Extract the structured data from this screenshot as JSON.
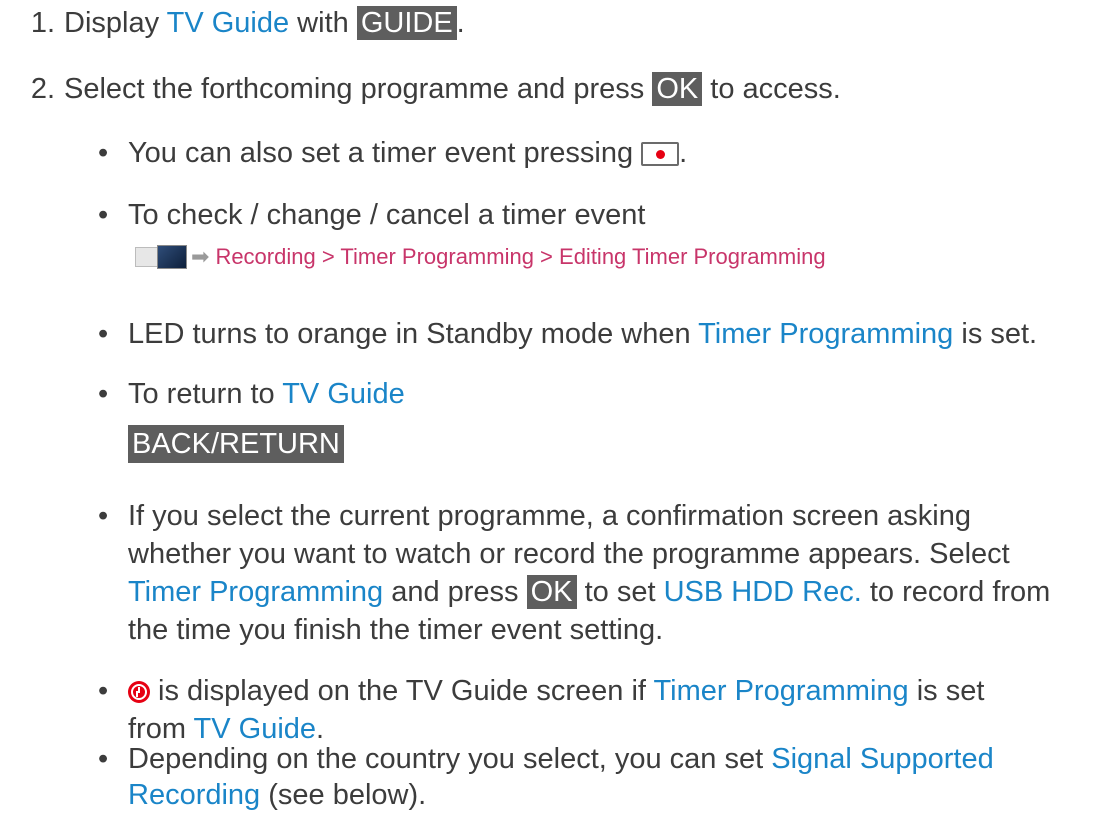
{
  "step1": {
    "number": "1.",
    "text_a": "Display ",
    "menu": "TV Guide",
    "text_b": " with ",
    "key": "GUIDE",
    "text_c": "."
  },
  "step2": {
    "number": "2.",
    "text_a": "Select the forthcoming programme and press ",
    "key": "OK",
    "text_b": " to access."
  },
  "bullet_char": "•",
  "b1": {
    "text_a": "You can also set a timer event pressing ",
    "text_b": "."
  },
  "b2": {
    "text": "To check / change / cancel a timer event"
  },
  "nav_path": {
    "text": "Recording > Timer Programming > Editing Timer Programming"
  },
  "b3": {
    "text_a": "LED turns to orange in Standby mode when ",
    "menu": "Timer Programming",
    "text_b": " is set."
  },
  "b4": {
    "text_a": "To return to ",
    "menu": "TV Guide"
  },
  "back_key": "BACK/RETURN",
  "b5": {
    "line1": "If you select the current programme, a confirmation screen asking",
    "line2": "whether you want to watch or record the programme appears. Select",
    "line3_menu1": "Timer Programming",
    "line3_a": " and press ",
    "line3_key": "OK",
    "line3_b": " to set ",
    "line3_menu2": "USB HDD Rec.",
    "line3_c": " to record from",
    "line4": "the time you finish the timer event setting."
  },
  "b6": {
    "text_a": " is displayed on the TV Guide screen if ",
    "menu1": "Timer Programming",
    "text_b": " is set",
    "line2_a": "from ",
    "menu2": "TV Guide",
    "line2_b": "."
  },
  "b7": {
    "text_a": "Depending on the country you select, you can set ",
    "menu1": "Signal Supported",
    "menu2": "Recording",
    "line2_b": " (see below)."
  },
  "icons": {
    "record_button": "record-button-icon",
    "timer_clock": "timer-clock-icon",
    "home_menu": "home-menu-icon",
    "arrow": "arrow-right-icon"
  },
  "colors": {
    "menu_text": "#1a85c8",
    "key_bg": "#5e5e5e",
    "path_text": "#c8356a",
    "record_dot": "#e60012"
  }
}
